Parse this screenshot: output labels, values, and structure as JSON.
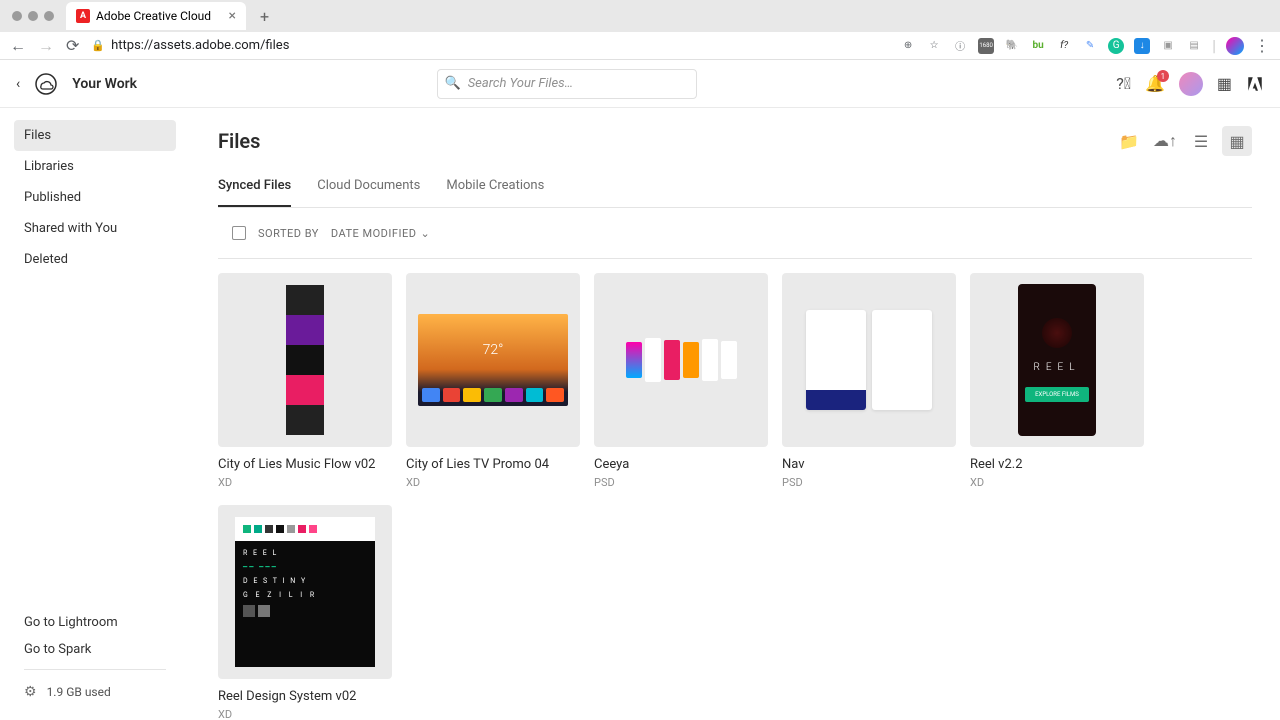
{
  "browser": {
    "tab_title": "Adobe Creative Cloud",
    "url": "https://assets.adobe.com/files"
  },
  "header": {
    "title": "Your Work",
    "search_placeholder": "Search Your Files…",
    "notification_count": "1"
  },
  "sidebar": {
    "items": [
      {
        "label": "Files",
        "active": true
      },
      {
        "label": "Libraries"
      },
      {
        "label": "Published"
      },
      {
        "label": "Shared with You"
      },
      {
        "label": "Deleted"
      }
    ],
    "links": [
      {
        "label": "Go to Lightroom"
      },
      {
        "label": "Go to Spark"
      }
    ],
    "storage_used": "1.9 GB used"
  },
  "content": {
    "page_title": "Files",
    "tabs": [
      {
        "label": "Synced Files",
        "active": true
      },
      {
        "label": "Cloud Documents"
      },
      {
        "label": "Mobile Creations"
      }
    ],
    "sort": {
      "label": "SORTED BY",
      "value": "DATE MODIFIED"
    },
    "files": [
      {
        "name": "City of Lies Music Flow v02",
        "type": "XD"
      },
      {
        "name": "City of Lies TV Promo 04",
        "type": "XD"
      },
      {
        "name": "Ceeya",
        "type": "PSD"
      },
      {
        "name": "Nav",
        "type": "PSD"
      },
      {
        "name": "Reel v2.2",
        "type": "XD"
      },
      {
        "name": "Reel Design System v02",
        "type": "XD"
      }
    ]
  }
}
